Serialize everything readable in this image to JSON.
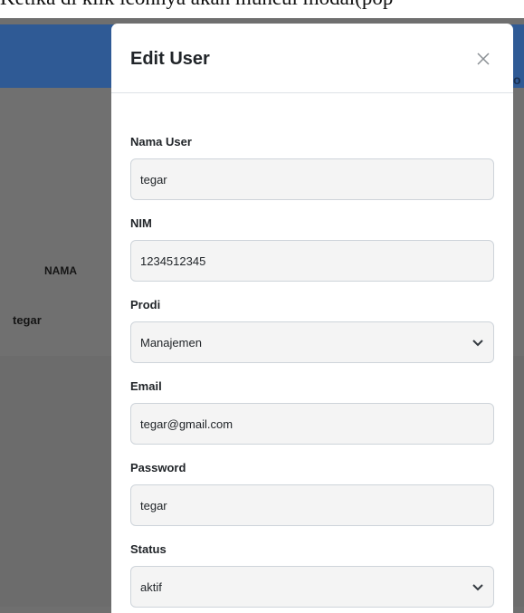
{
  "caption": "Ketika di klik iconnya akan muncul modal(pop",
  "background": {
    "column_header": "NAMA",
    "row_name": "tegar",
    "edge_glyph": "o",
    "header_color": "#2f5a95"
  },
  "modal": {
    "title": "Edit User",
    "close_icon": "close-icon",
    "fields": {
      "nama_user": {
        "label": "Nama User",
        "value": "tegar"
      },
      "nim": {
        "label": "NIM",
        "value": "1234512345"
      },
      "prodi": {
        "label": "Prodi",
        "value": "Manajemen",
        "icon": "chevron-down-icon"
      },
      "email": {
        "label": "Email",
        "value": "tegar@gmail.com"
      },
      "password": {
        "label": "Password",
        "value": "tegar"
      },
      "status": {
        "label": "Status",
        "value": "aktif",
        "icon": "chevron-down-icon"
      }
    }
  }
}
